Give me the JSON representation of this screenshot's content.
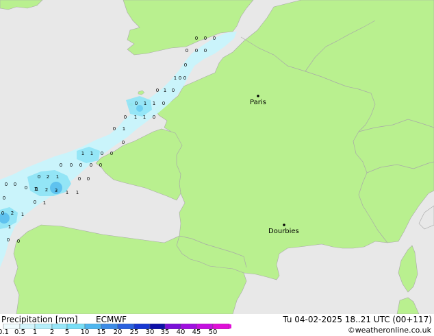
{
  "colors": {
    "sea": "#e8e8e8",
    "land": "#b9f08f",
    "border": "#a8a8a8",
    "precip_light": "#c8f4fc",
    "precip_medium": "#8fe4f6",
    "precip_heavy": "#5fc2ef"
  },
  "cities": [
    {
      "name": "Paris"
    },
    {
      "name": "Dourbies"
    }
  ],
  "precip_values": [
    "0",
    "0",
    "0",
    "0",
    "0",
    "0",
    "0",
    "0",
    "1",
    "0",
    "0",
    "1",
    "0",
    "0",
    "1",
    "1",
    "0",
    "0",
    "1",
    "1",
    "0",
    "0",
    "1",
    "0",
    "1",
    "1",
    "0",
    "0",
    "0",
    "0",
    "0",
    "0",
    "0",
    "0",
    "0",
    "0",
    "0",
    "2",
    "1",
    "0",
    "0",
    "0",
    "0",
    "1",
    "1",
    "2",
    "3",
    "1",
    "1",
    "0",
    "1",
    "0",
    "2",
    "1",
    "1",
    "0",
    "0"
  ],
  "footer": {
    "title": "Precipitation [mm]",
    "model": "ECMWF",
    "valid_time": "Tu 04-02-2025 18..21 UTC (00+117)",
    "credit": "©weatheronline.co.uk"
  },
  "legend": {
    "ticks": [
      "0.1",
      "0.5",
      "1",
      "2",
      "5",
      "10",
      "15",
      "20",
      "25",
      "30",
      "35",
      "40",
      "45",
      "50"
    ],
    "colors": [
      "#f0fbfd",
      "#d2f5fc",
      "#b4eefa",
      "#96e6f8",
      "#78def6",
      "#4fb6ee",
      "#3c8ce6",
      "#2a62de",
      "#1838d2",
      "#0e10a8",
      "#7a10d8",
      "#a010e0",
      "#c410e0",
      "#e010d8"
    ]
  }
}
